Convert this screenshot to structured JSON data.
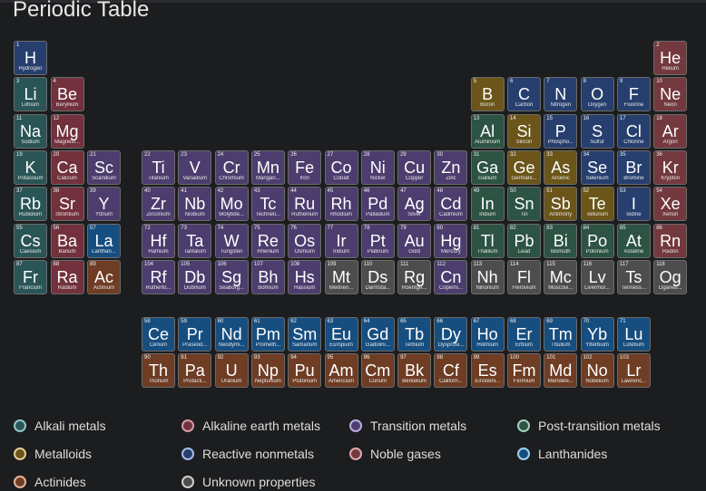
{
  "title": "Periodic Table",
  "categories": {
    "alkali": {
      "label": "Alkali metals",
      "fill": "#2a5557",
      "ring": "#8fc9c6"
    },
    "alkaline": {
      "label": "Alkaline earth metals",
      "fill": "#72313d",
      "ring": "#d59aa4"
    },
    "transition": {
      "label": "Transition metals",
      "fill": "#4c3d6e",
      "ring": "#b8aee0"
    },
    "post": {
      "label": "Post-transition metals",
      "fill": "#2c5343",
      "ring": "#a4d2bb"
    },
    "metalloid": {
      "label": "Metalloids",
      "fill": "#6b5519",
      "ring": "#e0cc96"
    },
    "nonmetal": {
      "label": "Reactive nonmetals",
      "fill": "#263f6e",
      "ring": "#a6bce6"
    },
    "noble": {
      "label": "Noble gases",
      "fill": "#73393f",
      "ring": "#e0a8b0"
    },
    "lanthanide": {
      "label": "Lanthanides",
      "fill": "#174e80",
      "ring": "#9ed2f2"
    },
    "actinide": {
      "label": "Actinides",
      "fill": "#6e3d24",
      "ring": "#e6b494"
    },
    "unknown": {
      "label": "Unknown properties",
      "fill": "#4d4d4d",
      "ring": "#cfcfcf"
    }
  },
  "legend_order": [
    "alkali",
    "alkaline",
    "transition",
    "post",
    "metalloid",
    "nonmetal",
    "noble",
    "lanthanide",
    "actinide",
    "unknown"
  ],
  "elements": [
    {
      "n": "1",
      "s": "H",
      "name": "Hydrogen",
      "cat": "nonmetal",
      "row": 1,
      "col": 1
    },
    {
      "n": "2",
      "s": "He",
      "name": "Helium",
      "cat": "noble",
      "row": 1,
      "col": 18
    },
    {
      "n": "3",
      "s": "Li",
      "name": "Lithium",
      "cat": "alkali",
      "row": 2,
      "col": 1
    },
    {
      "n": "4",
      "s": "Be",
      "name": "Beryllium",
      "cat": "alkaline",
      "row": 2,
      "col": 2
    },
    {
      "n": "5",
      "s": "B",
      "name": "Boron",
      "cat": "metalloid",
      "row": 2,
      "col": 13
    },
    {
      "n": "6",
      "s": "C",
      "name": "Carbon",
      "cat": "nonmetal",
      "row": 2,
      "col": 14
    },
    {
      "n": "7",
      "s": "N",
      "name": "Nitrogen",
      "cat": "nonmetal",
      "row": 2,
      "col": 15
    },
    {
      "n": "8",
      "s": "O",
      "name": "Oxygen",
      "cat": "nonmetal",
      "row": 2,
      "col": 16
    },
    {
      "n": "9",
      "s": "F",
      "name": "Fluorine",
      "cat": "nonmetal",
      "row": 2,
      "col": 17
    },
    {
      "n": "10",
      "s": "Ne",
      "name": "Neon",
      "cat": "noble",
      "row": 2,
      "col": 18
    },
    {
      "n": "11",
      "s": "Na",
      "name": "Sodium",
      "cat": "alkali",
      "row": 3,
      "col": 1
    },
    {
      "n": "12",
      "s": "Mg",
      "name": "Magnesi...",
      "cat": "alkaline",
      "row": 3,
      "col": 2
    },
    {
      "n": "13",
      "s": "Al",
      "name": "Aluminium",
      "cat": "post",
      "row": 3,
      "col": 13
    },
    {
      "n": "14",
      "s": "Si",
      "name": "Silicon",
      "cat": "metalloid",
      "row": 3,
      "col": 14
    },
    {
      "n": "15",
      "s": "P",
      "name": "Phospho...",
      "cat": "nonmetal",
      "row": 3,
      "col": 15
    },
    {
      "n": "16",
      "s": "S",
      "name": "Sulfur",
      "cat": "nonmetal",
      "row": 3,
      "col": 16
    },
    {
      "n": "17",
      "s": "Cl",
      "name": "Chlorine",
      "cat": "nonmetal",
      "row": 3,
      "col": 17
    },
    {
      "n": "18",
      "s": "Ar",
      "name": "Argon",
      "cat": "noble",
      "row": 3,
      "col": 18
    },
    {
      "n": "19",
      "s": "K",
      "name": "Potassium",
      "cat": "alkali",
      "row": 4,
      "col": 1
    },
    {
      "n": "20",
      "s": "Ca",
      "name": "Calcium",
      "cat": "alkaline",
      "row": 4,
      "col": 2
    },
    {
      "n": "21",
      "s": "Sc",
      "name": "Scandium",
      "cat": "transition",
      "row": 4,
      "col": 3
    },
    {
      "n": "22",
      "s": "Ti",
      "name": "Titanium",
      "cat": "transition",
      "row": 4,
      "col": 4
    },
    {
      "n": "23",
      "s": "V",
      "name": "Vanadium",
      "cat": "transition",
      "row": 4,
      "col": 5
    },
    {
      "n": "24",
      "s": "Cr",
      "name": "Chromium",
      "cat": "transition",
      "row": 4,
      "col": 6
    },
    {
      "n": "25",
      "s": "Mn",
      "name": "Mangan...",
      "cat": "transition",
      "row": 4,
      "col": 7
    },
    {
      "n": "26",
      "s": "Fe",
      "name": "Iron",
      "cat": "transition",
      "row": 4,
      "col": 8
    },
    {
      "n": "27",
      "s": "Co",
      "name": "Cobalt",
      "cat": "transition",
      "row": 4,
      "col": 9
    },
    {
      "n": "28",
      "s": "Ni",
      "name": "Nickel",
      "cat": "transition",
      "row": 4,
      "col": 10
    },
    {
      "n": "29",
      "s": "Cu",
      "name": "Copper",
      "cat": "transition",
      "row": 4,
      "col": 11
    },
    {
      "n": "30",
      "s": "Zn",
      "name": "Zinc",
      "cat": "transition",
      "row": 4,
      "col": 12
    },
    {
      "n": "31",
      "s": "Ga",
      "name": "Gallium",
      "cat": "post",
      "row": 4,
      "col": 13
    },
    {
      "n": "32",
      "s": "Ge",
      "name": "Germani...",
      "cat": "metalloid",
      "row": 4,
      "col": 14
    },
    {
      "n": "33",
      "s": "As",
      "name": "Arsenic",
      "cat": "metalloid",
      "row": 4,
      "col": 15
    },
    {
      "n": "34",
      "s": "Se",
      "name": "Selenium",
      "cat": "nonmetal",
      "row": 4,
      "col": 16
    },
    {
      "n": "35",
      "s": "Br",
      "name": "Bromine",
      "cat": "nonmetal",
      "row": 4,
      "col": 17
    },
    {
      "n": "36",
      "s": "Kr",
      "name": "Krypton",
      "cat": "noble",
      "row": 4,
      "col": 18
    },
    {
      "n": "37",
      "s": "Rb",
      "name": "Rubidium",
      "cat": "alkali",
      "row": 5,
      "col": 1
    },
    {
      "n": "38",
      "s": "Sr",
      "name": "Strontium",
      "cat": "alkaline",
      "row": 5,
      "col": 2
    },
    {
      "n": "39",
      "s": "Y",
      "name": "Yttrium",
      "cat": "transition",
      "row": 5,
      "col": 3
    },
    {
      "n": "40",
      "s": "Zr",
      "name": "Zirconium",
      "cat": "transition",
      "row": 5,
      "col": 4
    },
    {
      "n": "41",
      "s": "Nb",
      "name": "Niobium",
      "cat": "transition",
      "row": 5,
      "col": 5
    },
    {
      "n": "42",
      "s": "Mo",
      "name": "Molybde...",
      "cat": "transition",
      "row": 5,
      "col": 6
    },
    {
      "n": "43",
      "s": "Tc",
      "name": "Techneti...",
      "cat": "transition",
      "row": 5,
      "col": 7
    },
    {
      "n": "44",
      "s": "Ru",
      "name": "Ruthenium",
      "cat": "transition",
      "row": 5,
      "col": 8
    },
    {
      "n": "45",
      "s": "Rh",
      "name": "Rhodium",
      "cat": "transition",
      "row": 5,
      "col": 9
    },
    {
      "n": "46",
      "s": "Pd",
      "name": "Palladium",
      "cat": "transition",
      "row": 5,
      "col": 10
    },
    {
      "n": "47",
      "s": "Ag",
      "name": "Silver",
      "cat": "transition",
      "row": 5,
      "col": 11
    },
    {
      "n": "48",
      "s": "Cd",
      "name": "Cadmium",
      "cat": "transition",
      "row": 5,
      "col": 12
    },
    {
      "n": "49",
      "s": "In",
      "name": "Indium",
      "cat": "post",
      "row": 5,
      "col": 13
    },
    {
      "n": "50",
      "s": "Sn",
      "name": "Tin",
      "cat": "post",
      "row": 5,
      "col": 14
    },
    {
      "n": "51",
      "s": "Sb",
      "name": "Antimony",
      "cat": "metalloid",
      "row": 5,
      "col": 15
    },
    {
      "n": "52",
      "s": "Te",
      "name": "Tellurium",
      "cat": "metalloid",
      "row": 5,
      "col": 16
    },
    {
      "n": "53",
      "s": "I",
      "name": "Iodine",
      "cat": "nonmetal",
      "row": 5,
      "col": 17
    },
    {
      "n": "54",
      "s": "Xe",
      "name": "Xenon",
      "cat": "noble",
      "row": 5,
      "col": 18
    },
    {
      "n": "55",
      "s": "Cs",
      "name": "Caesium",
      "cat": "alkali",
      "row": 6,
      "col": 1
    },
    {
      "n": "56",
      "s": "Ba",
      "name": "Barium",
      "cat": "alkaline",
      "row": 6,
      "col": 2
    },
    {
      "n": "57",
      "s": "La",
      "name": "Lanthan...",
      "cat": "lanthanide",
      "row": 6,
      "col": 3
    },
    {
      "n": "72",
      "s": "Hf",
      "name": "Hafnium",
      "cat": "transition",
      "row": 6,
      "col": 4
    },
    {
      "n": "73",
      "s": "Ta",
      "name": "Tantalum",
      "cat": "transition",
      "row": 6,
      "col": 5
    },
    {
      "n": "74",
      "s": "W",
      "name": "Tungsten",
      "cat": "transition",
      "row": 6,
      "col": 6
    },
    {
      "n": "75",
      "s": "Re",
      "name": "Rhenium",
      "cat": "transition",
      "row": 6,
      "col": 7
    },
    {
      "n": "76",
      "s": "Os",
      "name": "Osmium",
      "cat": "transition",
      "row": 6,
      "col": 8
    },
    {
      "n": "77",
      "s": "Ir",
      "name": "Iridium",
      "cat": "transition",
      "row": 6,
      "col": 9
    },
    {
      "n": "78",
      "s": "Pt",
      "name": "Platinum",
      "cat": "transition",
      "row": 6,
      "col": 10
    },
    {
      "n": "79",
      "s": "Au",
      "name": "Gold",
      "cat": "transition",
      "row": 6,
      "col": 11
    },
    {
      "n": "80",
      "s": "Hg",
      "name": "Mercury",
      "cat": "transition",
      "row": 6,
      "col": 12
    },
    {
      "n": "81",
      "s": "Tl",
      "name": "Thallium",
      "cat": "post",
      "row": 6,
      "col": 13
    },
    {
      "n": "82",
      "s": "Pb",
      "name": "Lead",
      "cat": "post",
      "row": 6,
      "col": 14
    },
    {
      "n": "83",
      "s": "Bi",
      "name": "Bismuth",
      "cat": "post",
      "row": 6,
      "col": 15
    },
    {
      "n": "84",
      "s": "Po",
      "name": "Polonium",
      "cat": "post",
      "row": 6,
      "col": 16
    },
    {
      "n": "85",
      "s": "At",
      "name": "Astatine",
      "cat": "post",
      "row": 6,
      "col": 17
    },
    {
      "n": "86",
      "s": "Rn",
      "name": "Radon",
      "cat": "noble",
      "row": 6,
      "col": 18
    },
    {
      "n": "87",
      "s": "Fr",
      "name": "Francium",
      "cat": "alkali",
      "row": 7,
      "col": 1
    },
    {
      "n": "88",
      "s": "Ra",
      "name": "Radium",
      "cat": "alkaline",
      "row": 7,
      "col": 2
    },
    {
      "n": "89",
      "s": "Ac",
      "name": "Actinium",
      "cat": "actinide",
      "row": 7,
      "col": 3
    },
    {
      "n": "104",
      "s": "Rf",
      "name": "Rutherfo...",
      "cat": "transition",
      "row": 7,
      "col": 4
    },
    {
      "n": "105",
      "s": "Db",
      "name": "Dubnium",
      "cat": "transition",
      "row": 7,
      "col": 5
    },
    {
      "n": "106",
      "s": "Sg",
      "name": "Seaborg...",
      "cat": "transition",
      "row": 7,
      "col": 6
    },
    {
      "n": "107",
      "s": "Bh",
      "name": "Bohrium",
      "cat": "transition",
      "row": 7,
      "col": 7
    },
    {
      "n": "108",
      "s": "Hs",
      "name": "Hassium",
      "cat": "transition",
      "row": 7,
      "col": 8
    },
    {
      "n": "109",
      "s": "Mt",
      "name": "Meitneri...",
      "cat": "unknown",
      "row": 7,
      "col": 9
    },
    {
      "n": "110",
      "s": "Ds",
      "name": "Darmsta...",
      "cat": "unknown",
      "row": 7,
      "col": 10
    },
    {
      "n": "111",
      "s": "Rg",
      "name": "Roentge...",
      "cat": "unknown",
      "row": 7,
      "col": 11
    },
    {
      "n": "112",
      "s": "Cn",
      "name": "Coperni...",
      "cat": "transition",
      "row": 7,
      "col": 12
    },
    {
      "n": "113",
      "s": "Nh",
      "name": "Nihonium",
      "cat": "unknown",
      "row": 7,
      "col": 13
    },
    {
      "n": "114",
      "s": "Fl",
      "name": "Flerovium",
      "cat": "unknown",
      "row": 7,
      "col": 14
    },
    {
      "n": "115",
      "s": "Mc",
      "name": "Moscovi...",
      "cat": "unknown",
      "row": 7,
      "col": 15
    },
    {
      "n": "116",
      "s": "Lv",
      "name": "Livermor...",
      "cat": "unknown",
      "row": 7,
      "col": 16
    },
    {
      "n": "117",
      "s": "Ts",
      "name": "Tenness...",
      "cat": "unknown",
      "row": 7,
      "col": 17
    },
    {
      "n": "118",
      "s": "Og",
      "name": "Oganes...",
      "cat": "unknown",
      "row": 7,
      "col": 18
    },
    {
      "n": "58",
      "s": "Ce",
      "name": "Cerium",
      "cat": "lanthanide",
      "row": 9,
      "col": 4
    },
    {
      "n": "59",
      "s": "Pr",
      "name": "Praseod...",
      "cat": "lanthanide",
      "row": 9,
      "col": 5
    },
    {
      "n": "60",
      "s": "Nd",
      "name": "Neodymi...",
      "cat": "lanthanide",
      "row": 9,
      "col": 6
    },
    {
      "n": "61",
      "s": "Pm",
      "name": "Prometh...",
      "cat": "lanthanide",
      "row": 9,
      "col": 7
    },
    {
      "n": "62",
      "s": "Sm",
      "name": "Samarium",
      "cat": "lanthanide",
      "row": 9,
      "col": 8
    },
    {
      "n": "63",
      "s": "Eu",
      "name": "Europium",
      "cat": "lanthanide",
      "row": 9,
      "col": 9
    },
    {
      "n": "64",
      "s": "Gd",
      "name": "Gadolini...",
      "cat": "lanthanide",
      "row": 9,
      "col": 10
    },
    {
      "n": "65",
      "s": "Tb",
      "name": "Terbium",
      "cat": "lanthanide",
      "row": 9,
      "col": 11
    },
    {
      "n": "66",
      "s": "Dy",
      "name": "Dysprosi...",
      "cat": "lanthanide",
      "row": 9,
      "col": 12
    },
    {
      "n": "67",
      "s": "Ho",
      "name": "Holmium",
      "cat": "lanthanide",
      "row": 9,
      "col": 13
    },
    {
      "n": "68",
      "s": "Er",
      "name": "Erbium",
      "cat": "lanthanide",
      "row": 9,
      "col": 14
    },
    {
      "n": "69",
      "s": "Tm",
      "name": "Thulium",
      "cat": "lanthanide",
      "row": 9,
      "col": 15
    },
    {
      "n": "70",
      "s": "Yb",
      "name": "Ytterbium",
      "cat": "lanthanide",
      "row": 9,
      "col": 16
    },
    {
      "n": "71",
      "s": "Lu",
      "name": "Lutetium",
      "cat": "lanthanide",
      "row": 9,
      "col": 17
    },
    {
      "n": "90",
      "s": "Th",
      "name": "Thorium",
      "cat": "actinide",
      "row": 10,
      "col": 4
    },
    {
      "n": "91",
      "s": "Pa",
      "name": "Protacti...",
      "cat": "actinide",
      "row": 10,
      "col": 5
    },
    {
      "n": "92",
      "s": "U",
      "name": "Uranium",
      "cat": "actinide",
      "row": 10,
      "col": 6
    },
    {
      "n": "93",
      "s": "Np",
      "name": "Neptunium",
      "cat": "actinide",
      "row": 10,
      "col": 7
    },
    {
      "n": "94",
      "s": "Pu",
      "name": "Plutonium",
      "cat": "actinide",
      "row": 10,
      "col": 8
    },
    {
      "n": "95",
      "s": "Am",
      "name": "Americium",
      "cat": "actinide",
      "row": 10,
      "col": 9
    },
    {
      "n": "96",
      "s": "Cm",
      "name": "Curium",
      "cat": "actinide",
      "row": 10,
      "col": 10
    },
    {
      "n": "97",
      "s": "Bk",
      "name": "Berkelium",
      "cat": "actinide",
      "row": 10,
      "col": 11
    },
    {
      "n": "98",
      "s": "Cf",
      "name": "Californ...",
      "cat": "actinide",
      "row": 10,
      "col": 12
    },
    {
      "n": "99",
      "s": "Es",
      "name": "Einsteini...",
      "cat": "actinide",
      "row": 10,
      "col": 13
    },
    {
      "n": "100",
      "s": "Fm",
      "name": "Fermium",
      "cat": "actinide",
      "row": 10,
      "col": 14
    },
    {
      "n": "101",
      "s": "Md",
      "name": "Mendele...",
      "cat": "actinide",
      "row": 10,
      "col": 15
    },
    {
      "n": "102",
      "s": "No",
      "name": "Nobelium",
      "cat": "actinide",
      "row": 10,
      "col": 16
    },
    {
      "n": "103",
      "s": "Lr",
      "name": "Lawrenc...",
      "cat": "actinide",
      "row": 10,
      "col": 17
    }
  ]
}
